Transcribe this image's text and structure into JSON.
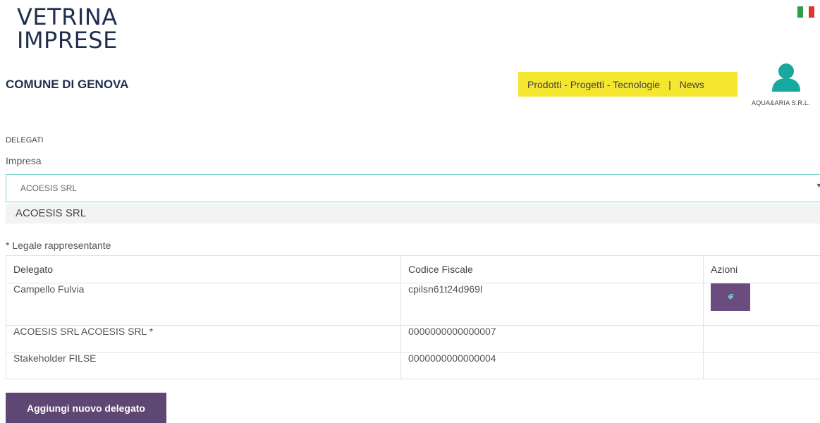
{
  "header": {
    "logo_line1": "VETRINA",
    "logo_line2": "IMPRESE",
    "comune": "COMUNE DI GENOVA",
    "nav_link1": "Prodotti - Progetti - Tecnologie",
    "nav_sep": "|",
    "nav_link2": "News",
    "user_name": "AQUA&ARIA S.R.L."
  },
  "colors": {
    "nav_bg": "#f5e630",
    "accent": "#6a4d7e",
    "user_icon": "#17a89e",
    "select_border": "#7fd6d1"
  },
  "flag_colors": [
    "#2f9e4a",
    "#ffffff",
    "#e0332f"
  ],
  "section_title": "DELEGATI",
  "impresa": {
    "label": "Impresa",
    "selected": "ACOESIS SRL",
    "option": "ACOESIS SRL"
  },
  "note": "* Legale rappresentante",
  "table": {
    "headers": [
      "Delegato",
      "Codice Fiscale",
      "Azioni"
    ],
    "rows": [
      {
        "delegato": "Campello Fulvia",
        "codice": "cpilsn61t24d969l",
        "has_action": true
      },
      {
        "delegato": "ACOESIS SRL ACOESIS SRL *",
        "codice": "0000000000000007",
        "has_action": false
      },
      {
        "delegato": "Stakeholder FILSE",
        "codice": "0000000000000004",
        "has_action": false
      }
    ]
  },
  "add_button": "Aggiungi nuovo delegato"
}
